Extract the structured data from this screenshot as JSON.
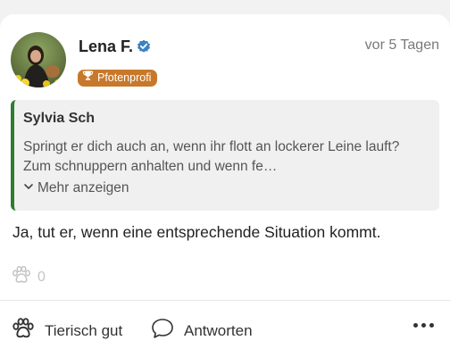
{
  "post": {
    "author": {
      "name": "Lena F.",
      "verified": true,
      "badge": "Pfotenprofi"
    },
    "timestamp": "vor 5 Tagen",
    "quote": {
      "author": "Sylvia Sch",
      "text": "Springt er dich auch an, wenn ihr flott an lockerer Leine lauft? Zum schnuppern anhalten und wenn fe…",
      "show_more_label": "Mehr anzeigen"
    },
    "text": "Ja, tut er, wenn eine entsprechende Situation kommt.",
    "reaction_count": "0"
  },
  "actions": {
    "like_label": "Tierisch gut",
    "reply_label": "Antworten"
  },
  "colors": {
    "badge": "#c8782a",
    "quote_bar": "#2e7d32",
    "verified": "#3b82c4"
  },
  "icons": {
    "verified": "verified-check-icon",
    "badge": "trophy-icon",
    "reaction": "paw-icon",
    "reply": "speech-bubble-icon",
    "more": "more-dots-icon"
  }
}
